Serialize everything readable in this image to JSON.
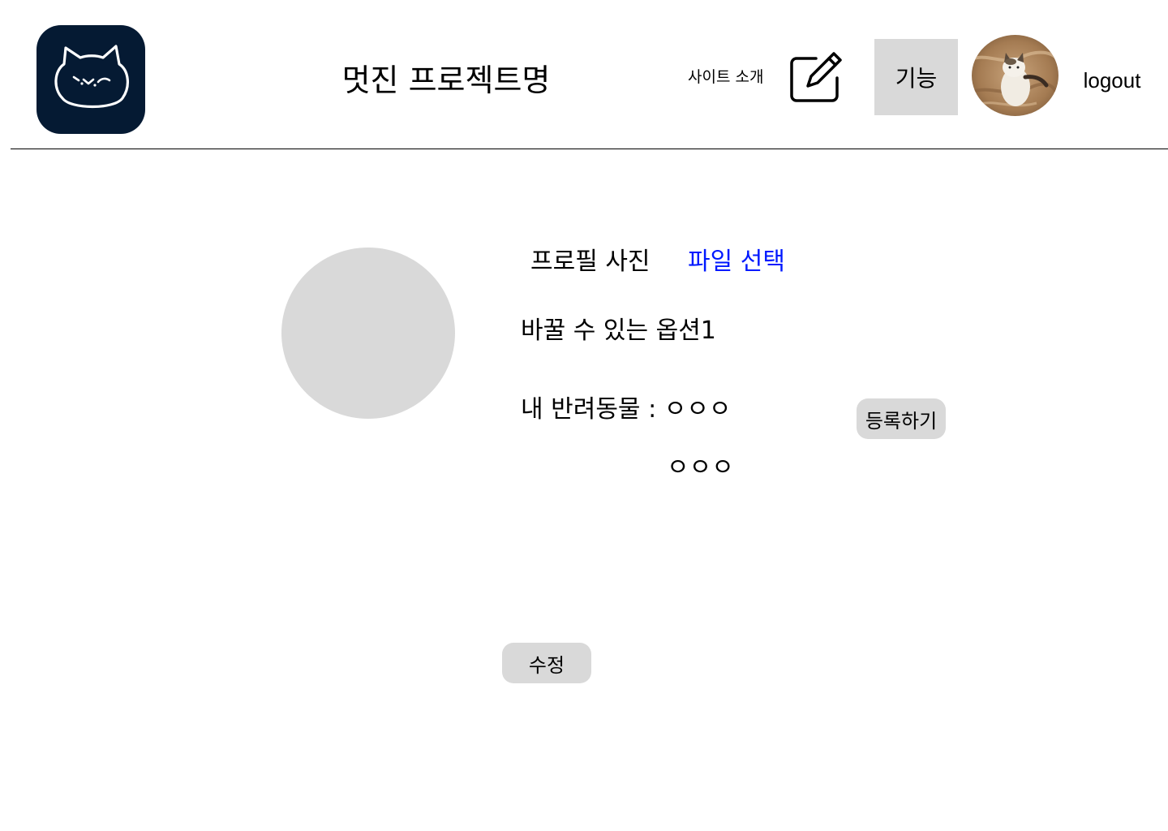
{
  "header": {
    "logo_icon": "cat-face-logo-icon",
    "logo_bg_color": "#051a33",
    "project_title": "멋진 프로젝트명",
    "nav_intro_label": "사이트 소개",
    "edit_icon": "pencil-square-icon",
    "feature_label": "기능",
    "avatar_icon": "cat-photo-avatar",
    "logout_label": "logout"
  },
  "profile": {
    "photo_label": "프로필 사진",
    "file_select_label": "파일 선택",
    "file_select_color": "#0019ff",
    "option1_label": "바꿀 수 있는 옵션1",
    "pet_label": "내 반려동물 : ㅇㅇㅇ",
    "pet_name_second": "ㅇㅇㅇ",
    "register_label": "등록하기",
    "edit_label": "수정"
  },
  "colors": {
    "placeholder_gray": "#d9d9d9"
  }
}
